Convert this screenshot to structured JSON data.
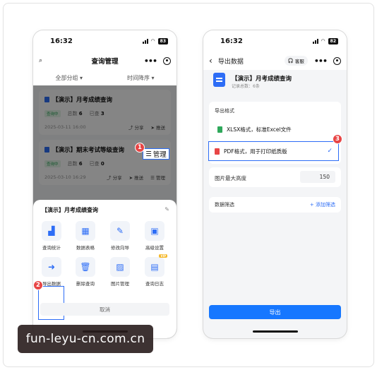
{
  "colors": {
    "accent": "#2d6df6",
    "step_badge": "#e84545",
    "primary_button": "#1677ff"
  },
  "phone1": {
    "status": {
      "time": "16:32",
      "battery": "83"
    },
    "nav": {
      "title": "查询管理",
      "left_icon": "search-icon",
      "more_icon": "more-icon",
      "target_icon": "target-icon"
    },
    "filter": {
      "group": "全部分组",
      "sort": "时间降序"
    },
    "cards": [
      {
        "title": "【演示】月考成绩查询",
        "badge": "查询中",
        "total_label": "总数",
        "total": "6",
        "done_label": "已查",
        "done": "3",
        "date": "2025-03-11 16:00",
        "share": "分享",
        "push": "推送",
        "manage": "管理"
      },
      {
        "title": "【演示】期末考试等级查询",
        "badge": "查询中",
        "total_label": "总数",
        "total": "6",
        "done_label": "已查",
        "done": "0",
        "date": "2025-03-10 16:29",
        "share": "分享",
        "push": "推送",
        "manage": "管理"
      }
    ],
    "highlight_manage": "管理",
    "steps": {
      "s1": "1",
      "s2": "2"
    },
    "sheet": {
      "title": "【演示】月考成绩查询",
      "items": [
        {
          "label": "查询统计",
          "icon": "chart-icon"
        },
        {
          "label": "数据表格",
          "icon": "table-icon"
        },
        {
          "label": "修改向导",
          "icon": "pencil-icon"
        },
        {
          "label": "高级设置",
          "icon": "grid-icon"
        },
        {
          "label": "导出数据",
          "icon": "export-icon"
        },
        {
          "label": "删除查询",
          "icon": "trash-icon"
        },
        {
          "label": "图片管理",
          "icon": "image-icon"
        },
        {
          "label": "查询日志",
          "icon": "log-icon",
          "badge": "VIP"
        }
      ],
      "cancel": "取消"
    }
  },
  "phone2": {
    "status": {
      "time": "16:32",
      "battery": "82"
    },
    "nav": {
      "title": "导出数据",
      "customer_service": "客服"
    },
    "header": {
      "title": "【演示】月考成绩查询",
      "subtitle": "记录总数：6条"
    },
    "format_section": "导出格式",
    "formats": [
      {
        "label": "XLSX格式，标准Excel文件",
        "selected": false
      },
      {
        "label": "PDF格式，用于打印纸质版",
        "selected": true
      }
    ],
    "step3": "3",
    "max_height": {
      "label": "图片最大高度",
      "value": "150"
    },
    "filter": {
      "label": "数据筛选",
      "add": "+ 添加筛选"
    },
    "export_button": "导出"
  },
  "watermark": "fun-leyu-cn.com.cn"
}
